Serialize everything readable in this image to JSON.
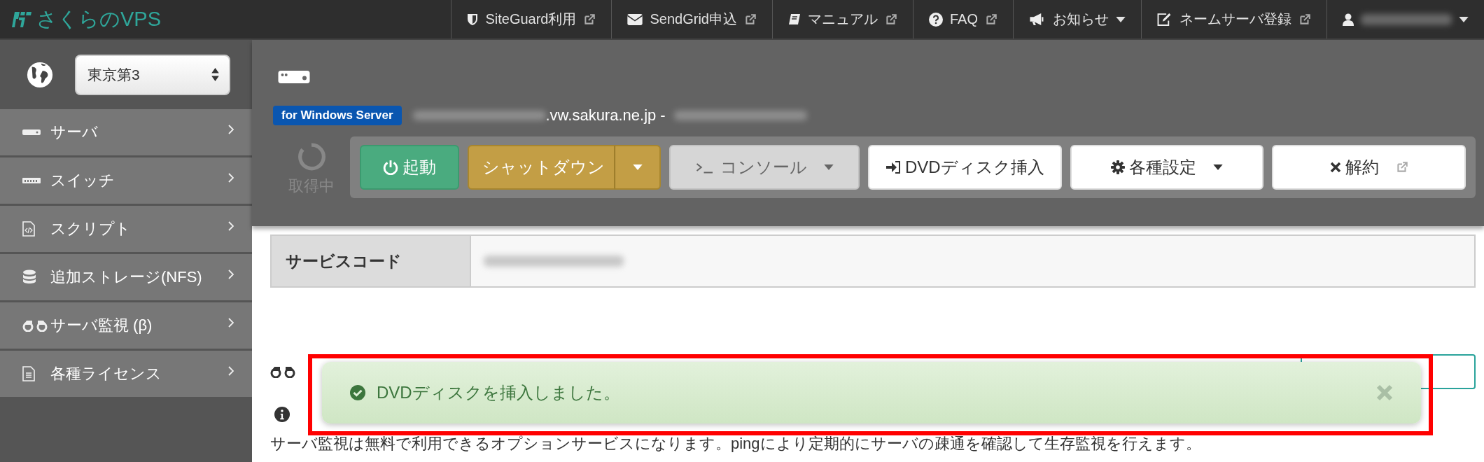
{
  "brand": {
    "name": "さくらのVPS"
  },
  "top_nav": [
    {
      "label": "SiteGuard利用",
      "kind": "shield",
      "external": true,
      "dropdown": false
    },
    {
      "label": "SendGrid申込",
      "kind": "envelope",
      "external": true,
      "dropdown": false
    },
    {
      "label": "マニュアル",
      "kind": "book",
      "external": true,
      "dropdown": false
    },
    {
      "label": "FAQ",
      "kind": "question",
      "external": true,
      "dropdown": false
    },
    {
      "label": "お知らせ",
      "kind": "bullhorn",
      "external": false,
      "dropdown": true
    },
    {
      "label": "ネームサーバ登録",
      "kind": "edit",
      "external": true,
      "dropdown": false
    },
    {
      "kind": "user",
      "external": false,
      "dropdown": true
    }
  ],
  "region_select": {
    "value": "東京第3"
  },
  "sidebar": {
    "items": [
      {
        "label": "サーバ",
        "kind": "server"
      },
      {
        "label": "スイッチ",
        "kind": "switch"
      },
      {
        "label": "スクリプト",
        "kind": "script"
      },
      {
        "label": "追加ストレージ(NFS)",
        "kind": "database"
      },
      {
        "label": "サーバ監視 (β)",
        "kind": "binoculars"
      },
      {
        "label": "各種ライセンス",
        "kind": "document"
      }
    ]
  },
  "server": {
    "badge": "for Windows Server",
    "hostname": ".vw.sakura.ne.jp -",
    "status": "取得中"
  },
  "actions": [
    {
      "label": "起動",
      "kind": "start",
      "dropdown": false,
      "external": false
    },
    {
      "label": "シャットダウン",
      "kind": "shutdown",
      "dropdown": true,
      "external": false
    },
    {
      "label": "コンソール",
      "kind": "console",
      "dropdown": true,
      "external": false
    },
    {
      "label": "DVDディスク挿入",
      "kind": "insert",
      "dropdown": false,
      "external": false
    },
    {
      "label": "各種設定",
      "kind": "settings",
      "dropdown": true,
      "external": false
    },
    {
      "label": "解約",
      "kind": "cancel",
      "dropdown": false,
      "external": true
    }
  ],
  "details": {
    "rows": [
      {
        "label": "サービスコード"
      }
    ]
  },
  "monitoring": {
    "description": "サーバ監視は無料で利用できるオプションサービスになります。pingにより定期的にサーバの疎通を確認して生存監視を行えます。"
  },
  "toast": {
    "message": "DVDディスクを挿入しました。"
  }
}
